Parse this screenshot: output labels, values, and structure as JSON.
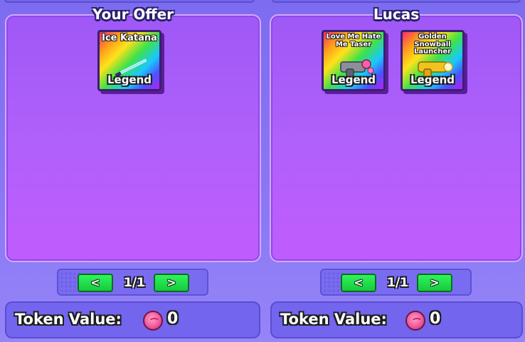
{
  "left_panel": {
    "title": "Your Offer",
    "items": [
      {
        "name": "Ice Katana",
        "rarity": "Legend",
        "icon": "ice-katana-icon"
      }
    ],
    "pager": {
      "prev": "<",
      "next": ">",
      "page": "1/1"
    },
    "token": {
      "label": "Token Value:",
      "value": "0",
      "icon": "token-coin-icon"
    }
  },
  "right_panel": {
    "title": "Lucas",
    "items": [
      {
        "name": "Love Me Hate Me Taser",
        "rarity": "Legend",
        "icon": "love-me-hate-me-taser-icon"
      },
      {
        "name": "Golden Snowball Launcher",
        "rarity": "Legend",
        "icon": "golden-snowball-launcher-icon"
      }
    ],
    "pager": {
      "prev": "<",
      "next": ">",
      "page": "1/1"
    },
    "token": {
      "label": "Token Value:",
      "value": "0",
      "icon": "token-coin-icon"
    }
  },
  "colors": {
    "background": "#8a78f5",
    "offer_box": "#b060fb",
    "pager_button": "#17c93e",
    "token_coin": "#f15a9d"
  }
}
